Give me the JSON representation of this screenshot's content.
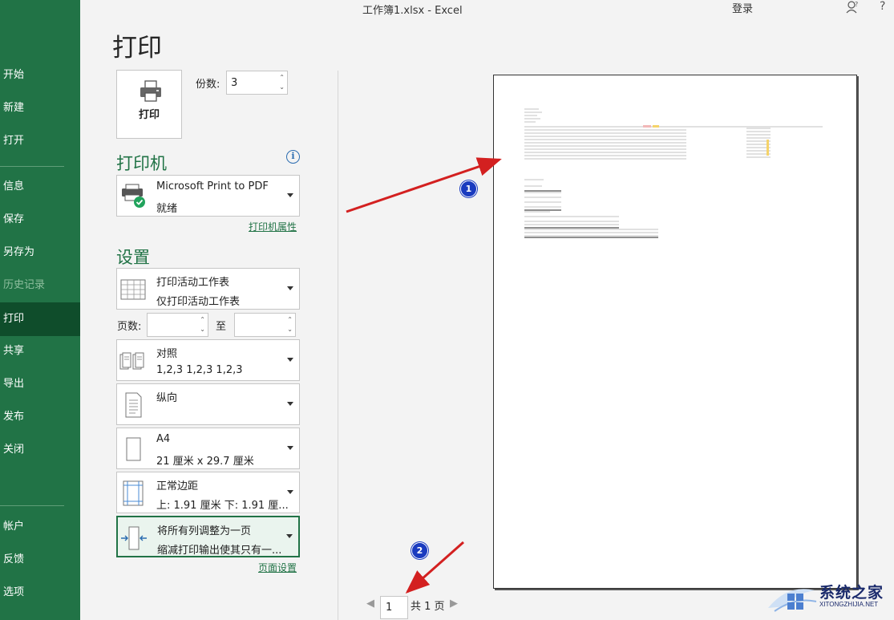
{
  "window": {
    "title": "工作簿1.xlsx  -  Excel",
    "login": "登录",
    "help": "?"
  },
  "sidebar": {
    "items": [
      {
        "label": "开始"
      },
      {
        "label": "新建"
      },
      {
        "label": "打开"
      },
      {
        "label": "信息"
      },
      {
        "label": "保存"
      },
      {
        "label": "另存为"
      },
      {
        "label": "历史记录"
      },
      {
        "label": "打印"
      },
      {
        "label": "共享"
      },
      {
        "label": "导出"
      },
      {
        "label": "发布"
      },
      {
        "label": "关闭"
      },
      {
        "label": "帐户"
      },
      {
        "label": "反馈"
      },
      {
        "label": "选项"
      }
    ],
    "active": "打印",
    "disabled": "历史记录"
  },
  "page_title": "打印",
  "print_button": {
    "label": "打印"
  },
  "copies": {
    "label": "份数:",
    "value": "3"
  },
  "printer": {
    "heading": "打印机",
    "name": "Microsoft Print to PDF",
    "status": "就绪",
    "properties_link": "打印机属性"
  },
  "settings": {
    "heading": "设置",
    "what": {
      "line1": "打印活动工作表",
      "line2": "仅打印活动工作表"
    },
    "pages": {
      "label": "页数:",
      "from": "",
      "to_label": "至",
      "to": ""
    },
    "collate": {
      "line1": "对照",
      "line2": "1,2,3    1,2,3    1,2,3"
    },
    "orientation": {
      "line1": "纵向"
    },
    "paper": {
      "line1": "A4",
      "line2": "21 厘米 x 29.7 厘米"
    },
    "margins": {
      "line1": "正常边距",
      "line2": "上: 1.91 厘米 下: 1.91 厘..."
    },
    "scaling": {
      "line1": "将所有列调整为一页",
      "line2": "缩减打印输出使其只有一..."
    },
    "page_setup_link": "页面设置"
  },
  "pager": {
    "current": "1",
    "total_text": "共 1 页"
  },
  "annotations": {
    "marker1": "1",
    "marker2": "2"
  },
  "watermark": {
    "text": "系统之家",
    "sub": "XITONGZHIJIA.NET"
  },
  "colors": {
    "accent": "#217346",
    "sidebar": "#217346",
    "sidebar_active": "#0f4d2b",
    "marker": "#1a3bbf",
    "arrow": "#d32020"
  }
}
